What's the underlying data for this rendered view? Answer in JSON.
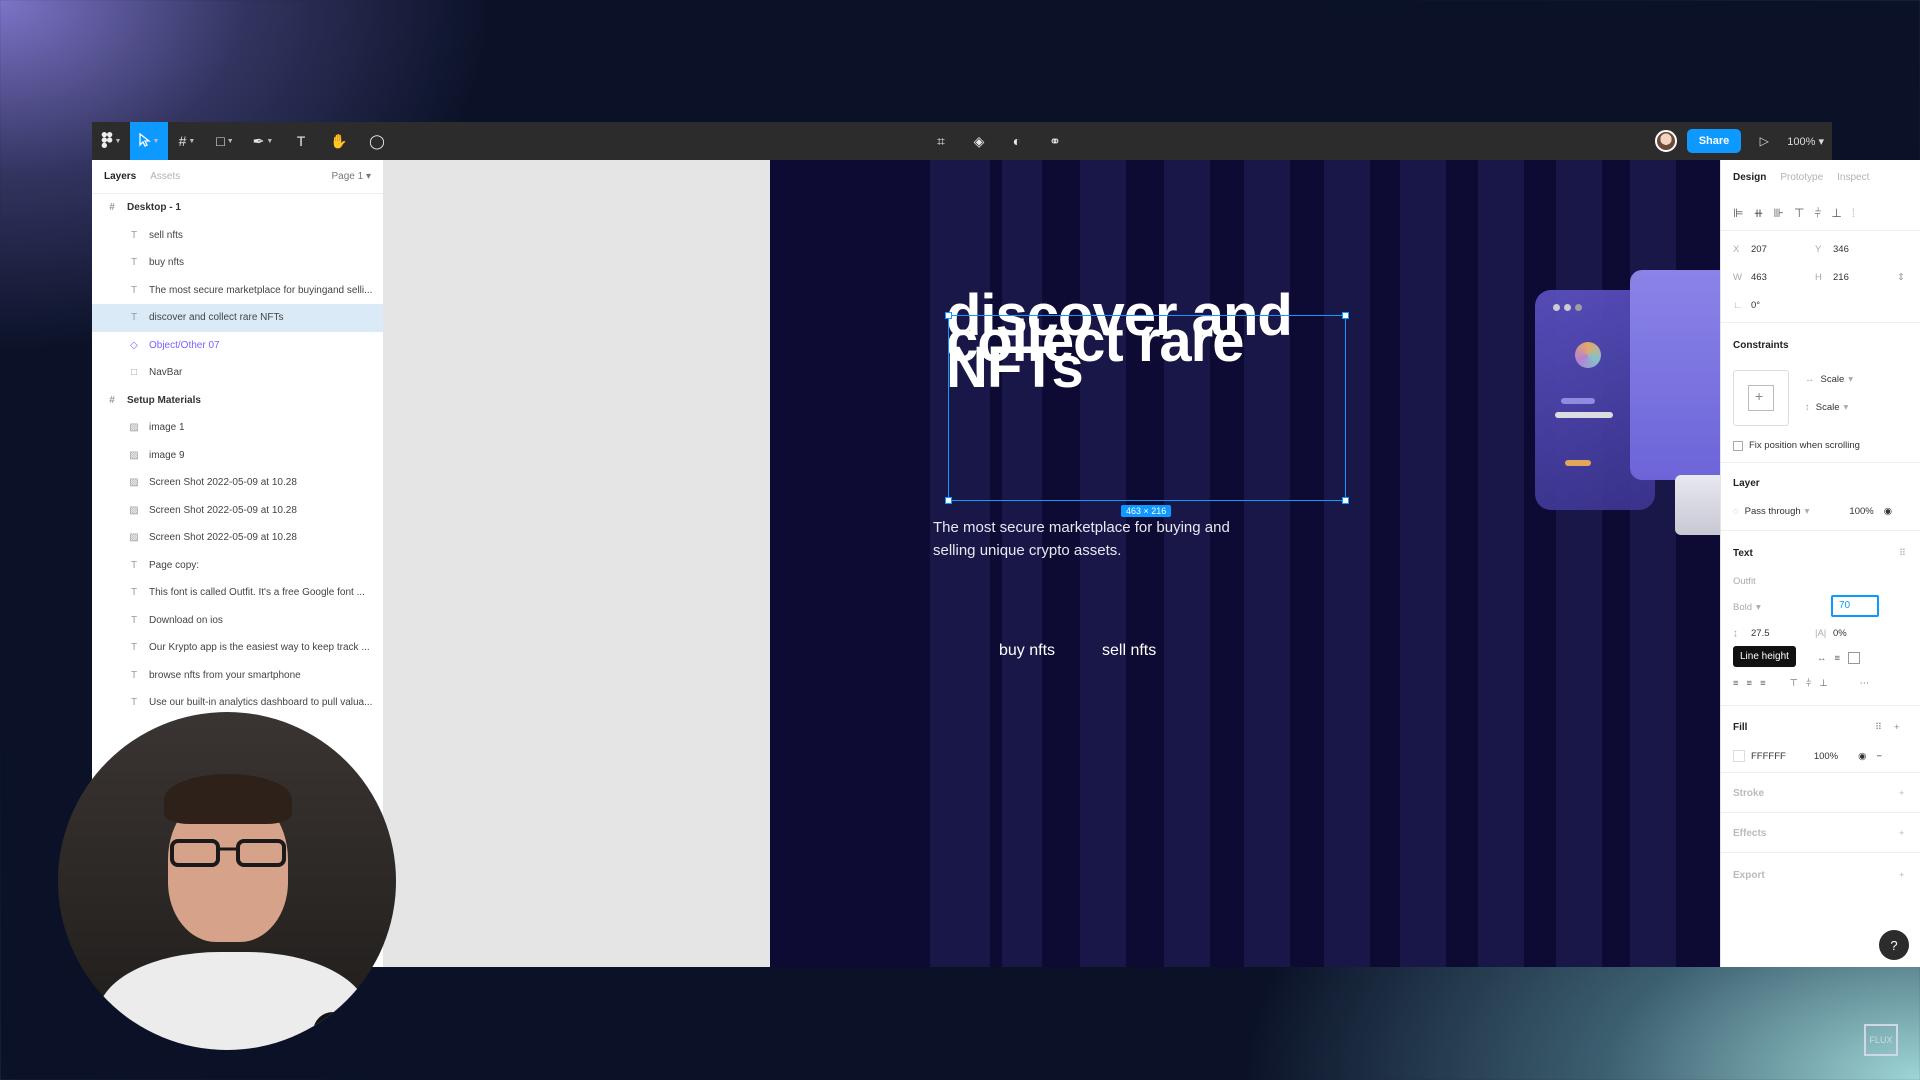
{
  "toolbar": {
    "share_label": "Share",
    "zoom_label": "100%"
  },
  "layers_panel": {
    "tab_layers": "Layers",
    "tab_assets": "Assets",
    "page_label": "Page 1",
    "items": [
      {
        "label": "Desktop - 1",
        "kind": "frame"
      },
      {
        "label": "sell nfts",
        "kind": "text"
      },
      {
        "label": "buy nfts",
        "kind": "text"
      },
      {
        "label": "The most secure marketplace for buyingand selli...",
        "kind": "text"
      },
      {
        "label": "discover and collect rare NFTs",
        "kind": "text",
        "selected": true
      },
      {
        "label": "Object/Other 07",
        "kind": "component"
      },
      {
        "label": "NavBar",
        "kind": "rect"
      },
      {
        "label": "Setup Materials",
        "kind": "frame"
      },
      {
        "label": "image 1",
        "kind": "image"
      },
      {
        "label": "image 9",
        "kind": "image"
      },
      {
        "label": "Screen Shot 2022-05-09 at 10.28",
        "kind": "image"
      },
      {
        "label": "Screen Shot 2022-05-09 at 10.28",
        "kind": "image"
      },
      {
        "label": "Screen Shot 2022-05-09 at 10.28",
        "kind": "image"
      },
      {
        "label": "Page copy:",
        "kind": "text"
      },
      {
        "label": "This font is called Outfit. It's a free Google font ...",
        "kind": "text"
      },
      {
        "label": "Download on ios",
        "kind": "text"
      },
      {
        "label": "Our Krypto app is the easiest way to keep track ...",
        "kind": "text"
      },
      {
        "label": "browse nfts from your smartphone",
        "kind": "text"
      },
      {
        "label": "Use our built-in analytics dashboard to pull valua...",
        "kind": "text"
      }
    ]
  },
  "canvas": {
    "hero_title_line1": "discover and",
    "hero_title_line2": "collect rare",
    "hero_title_line3": "NFTs",
    "selection_size": "463 × 216",
    "hero_subtitle": "The most secure marketplace for buying and selling unique crypto assets.",
    "buy_button": "buy nfts",
    "sell_button": "sell nfts"
  },
  "design_panel": {
    "tab_design": "Design",
    "tab_prototype": "Prototype",
    "tab_inspect": "Inspect",
    "x_label": "X",
    "x_value": "207",
    "y_label": "Y",
    "y_value": "346",
    "w_label": "W",
    "w_value": "463",
    "h_label": "H",
    "h_value": "216",
    "rotation_value": "0°",
    "constraints_title": "Constraints",
    "constraint_h": "Scale",
    "constraint_v": "Scale",
    "fix_position_label": "Fix position when scrolling",
    "layer_title": "Layer",
    "blend_mode": "Pass through",
    "layer_opacity": "100%",
    "text_title": "Text",
    "font_family": "Outfit",
    "font_weight": "Bold",
    "font_size": "70",
    "line_height": "27.5",
    "letter_spacing": "0%",
    "tooltip": "Line height",
    "fill_title": "Fill",
    "fill_hex": "FFFFFF",
    "fill_opacity": "100%",
    "stroke_title": "Stroke",
    "effects_title": "Effects",
    "export_title": "Export",
    "help_label": "?"
  },
  "colors": {
    "accent": "#0d99ff",
    "frame_bg": "#0d0b33",
    "stripe": "#191648",
    "toolbar_bg": "#2c2c2c"
  }
}
